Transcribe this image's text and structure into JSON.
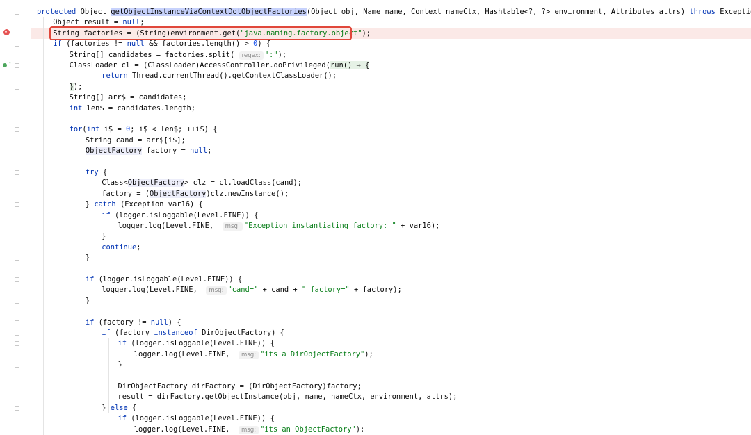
{
  "editor": {
    "language": "java",
    "icons": {
      "breakpoint": "breakpoint-icon",
      "override": "override-gutter-icon",
      "fold": "fold-marker-icon"
    },
    "lines": [
      {
        "indent": 0,
        "segs": [
          [
            "kw",
            "protected"
          ],
          [
            "plain",
            " Object "
          ],
          [
            "method-hl",
            "getObjectInstanceViaContextDotObjectFactories"
          ],
          [
            "plain",
            "(Object obj, Name name, Context nameCtx, Hashtable<?, ?> environment, Attributes attrs) "
          ],
          [
            "kw",
            "throws"
          ],
          [
            "plain",
            " Exception {"
          ]
        ]
      },
      {
        "indent": 1,
        "segs": [
          [
            "plain",
            "Object result = "
          ],
          [
            "kw",
            "null"
          ],
          [
            "plain",
            ";"
          ]
        ]
      },
      {
        "indent": 1,
        "bp": true,
        "segs": [
          [
            "plain",
            "String factories = (String)environment.get("
          ],
          [
            "str",
            "\"java.naming.factory.object\""
          ],
          [
            "plain",
            ");"
          ]
        ]
      },
      {
        "indent": 1,
        "segs": [
          [
            "kw",
            "if"
          ],
          [
            "plain",
            " (factories != "
          ],
          [
            "kw",
            "null"
          ],
          [
            "plain",
            " && factories.length() > "
          ],
          [
            "num",
            "0"
          ],
          [
            "plain",
            ") {"
          ]
        ]
      },
      {
        "indent": 2,
        "segs": [
          [
            "plain",
            "String[] candidates = factories.split( "
          ],
          [
            "hint",
            "regex:"
          ],
          [
            "str",
            "\":\""
          ],
          [
            "plain",
            ");"
          ]
        ]
      },
      {
        "indent": 2,
        "segs": [
          [
            "plain",
            "ClassLoader cl = (ClassLoader)AccessController.doPrivileged("
          ],
          [
            "lambda",
            "run() → {"
          ]
        ]
      },
      {
        "indent": 4,
        "segs": [
          [
            "kw",
            "return"
          ],
          [
            "plain",
            " Thread.currentThread().getContextClassLoader();"
          ]
        ]
      },
      {
        "indent": 2,
        "segs": [
          [
            "lambda",
            "}"
          ],
          [
            "plain",
            ");"
          ]
        ]
      },
      {
        "indent": 2,
        "segs": [
          [
            "plain",
            "String[] arr$ = candidates;"
          ]
        ]
      },
      {
        "indent": 2,
        "segs": [
          [
            "kw",
            "int"
          ],
          [
            "plain",
            " len$ = candidates.length;"
          ]
        ]
      },
      {
        "indent": 0,
        "segs": []
      },
      {
        "indent": 2,
        "segs": [
          [
            "kw",
            "for"
          ],
          [
            "plain",
            "("
          ],
          [
            "kw",
            "int"
          ],
          [
            "plain",
            " i$ = "
          ],
          [
            "num",
            "0"
          ],
          [
            "plain",
            "; i$ < len$; ++i$) {"
          ]
        ]
      },
      {
        "indent": 3,
        "segs": [
          [
            "plain",
            "String cand = arr$[i$];"
          ]
        ]
      },
      {
        "indent": 3,
        "segs": [
          [
            "cls",
            "ObjectFactory"
          ],
          [
            "plain",
            " factory = "
          ],
          [
            "kw",
            "null"
          ],
          [
            "plain",
            ";"
          ]
        ]
      },
      {
        "indent": 0,
        "segs": []
      },
      {
        "indent": 3,
        "segs": [
          [
            "kw",
            "try"
          ],
          [
            "plain",
            " {"
          ]
        ]
      },
      {
        "indent": 4,
        "segs": [
          [
            "plain",
            "Class<"
          ],
          [
            "cls",
            "ObjectFactory"
          ],
          [
            "plain",
            "> clz = cl.loadClass(cand);"
          ]
        ]
      },
      {
        "indent": 4,
        "segs": [
          [
            "plain",
            "factory = ("
          ],
          [
            "cls",
            "ObjectFactory"
          ],
          [
            "plain",
            ")clz.newInstance();"
          ]
        ]
      },
      {
        "indent": 3,
        "segs": [
          [
            "plain",
            "} "
          ],
          [
            "kw",
            "catch"
          ],
          [
            "plain",
            " (Exception var16) {"
          ]
        ]
      },
      {
        "indent": 4,
        "segs": [
          [
            "kw",
            "if"
          ],
          [
            "plain",
            " (logger.isLoggable(Level.FINE)) {"
          ]
        ]
      },
      {
        "indent": 5,
        "segs": [
          [
            "plain",
            "logger.log(Level.FINE,  "
          ],
          [
            "hint",
            "msg:"
          ],
          [
            "str",
            "\"Exception instantiating factory: \""
          ],
          [
            "plain",
            " + var16);"
          ]
        ]
      },
      {
        "indent": 4,
        "segs": [
          [
            "plain",
            "}"
          ]
        ]
      },
      {
        "indent": 4,
        "segs": [
          [
            "kw",
            "continue"
          ],
          [
            "plain",
            ";"
          ]
        ]
      },
      {
        "indent": 3,
        "segs": [
          [
            "plain",
            "}"
          ]
        ]
      },
      {
        "indent": 0,
        "segs": []
      },
      {
        "indent": 3,
        "segs": [
          [
            "kw",
            "if"
          ],
          [
            "plain",
            " (logger.isLoggable(Level.FINE)) {"
          ]
        ]
      },
      {
        "indent": 4,
        "segs": [
          [
            "plain",
            "logger.log(Level.FINE,  "
          ],
          [
            "hint",
            "msg:"
          ],
          [
            "str",
            "\"cand=\""
          ],
          [
            "plain",
            " + cand + "
          ],
          [
            "str",
            "\" factory=\""
          ],
          [
            "plain",
            " + factory);"
          ]
        ]
      },
      {
        "indent": 3,
        "segs": [
          [
            "plain",
            "}"
          ]
        ]
      },
      {
        "indent": 0,
        "segs": []
      },
      {
        "indent": 3,
        "segs": [
          [
            "kw",
            "if"
          ],
          [
            "plain",
            " (factory != "
          ],
          [
            "kw",
            "null"
          ],
          [
            "plain",
            ") {"
          ]
        ]
      },
      {
        "indent": 4,
        "segs": [
          [
            "kw",
            "if"
          ],
          [
            "plain",
            " (factory "
          ],
          [
            "kw",
            "instanceof"
          ],
          [
            "plain",
            " DirObjectFactory) {"
          ]
        ]
      },
      {
        "indent": 5,
        "segs": [
          [
            "kw",
            "if"
          ],
          [
            "plain",
            " (logger.isLoggable(Level.FINE)) {"
          ]
        ]
      },
      {
        "indent": 6,
        "segs": [
          [
            "plain",
            "logger.log(Level.FINE,  "
          ],
          [
            "hint",
            "msg:"
          ],
          [
            "str",
            "\"its a DirObjectFactory\""
          ],
          [
            "plain",
            ");"
          ]
        ]
      },
      {
        "indent": 5,
        "segs": [
          [
            "plain",
            "}"
          ]
        ]
      },
      {
        "indent": 0,
        "segs": []
      },
      {
        "indent": 5,
        "segs": [
          [
            "plain",
            "DirObjectFactory dirFactory = (DirObjectFactory)factory;"
          ]
        ]
      },
      {
        "indent": 5,
        "segs": [
          [
            "plain",
            "result = dirFactory.getObjectInstance(obj, name, nameCtx, environment, attrs);"
          ]
        ]
      },
      {
        "indent": 4,
        "segs": [
          [
            "plain",
            "} "
          ],
          [
            "kw",
            "else"
          ],
          [
            "plain",
            " {"
          ]
        ]
      },
      {
        "indent": 5,
        "segs": [
          [
            "kw",
            "if"
          ],
          [
            "plain",
            " (logger.isLoggable(Level.FINE)) {"
          ]
        ]
      },
      {
        "indent": 6,
        "segs": [
          [
            "plain",
            "logger.log(Level.FINE,  "
          ],
          [
            "hint",
            "msg:"
          ],
          [
            "str",
            "\"its an ObjectFactory\""
          ],
          [
            "plain",
            ");"
          ]
        ]
      }
    ]
  }
}
